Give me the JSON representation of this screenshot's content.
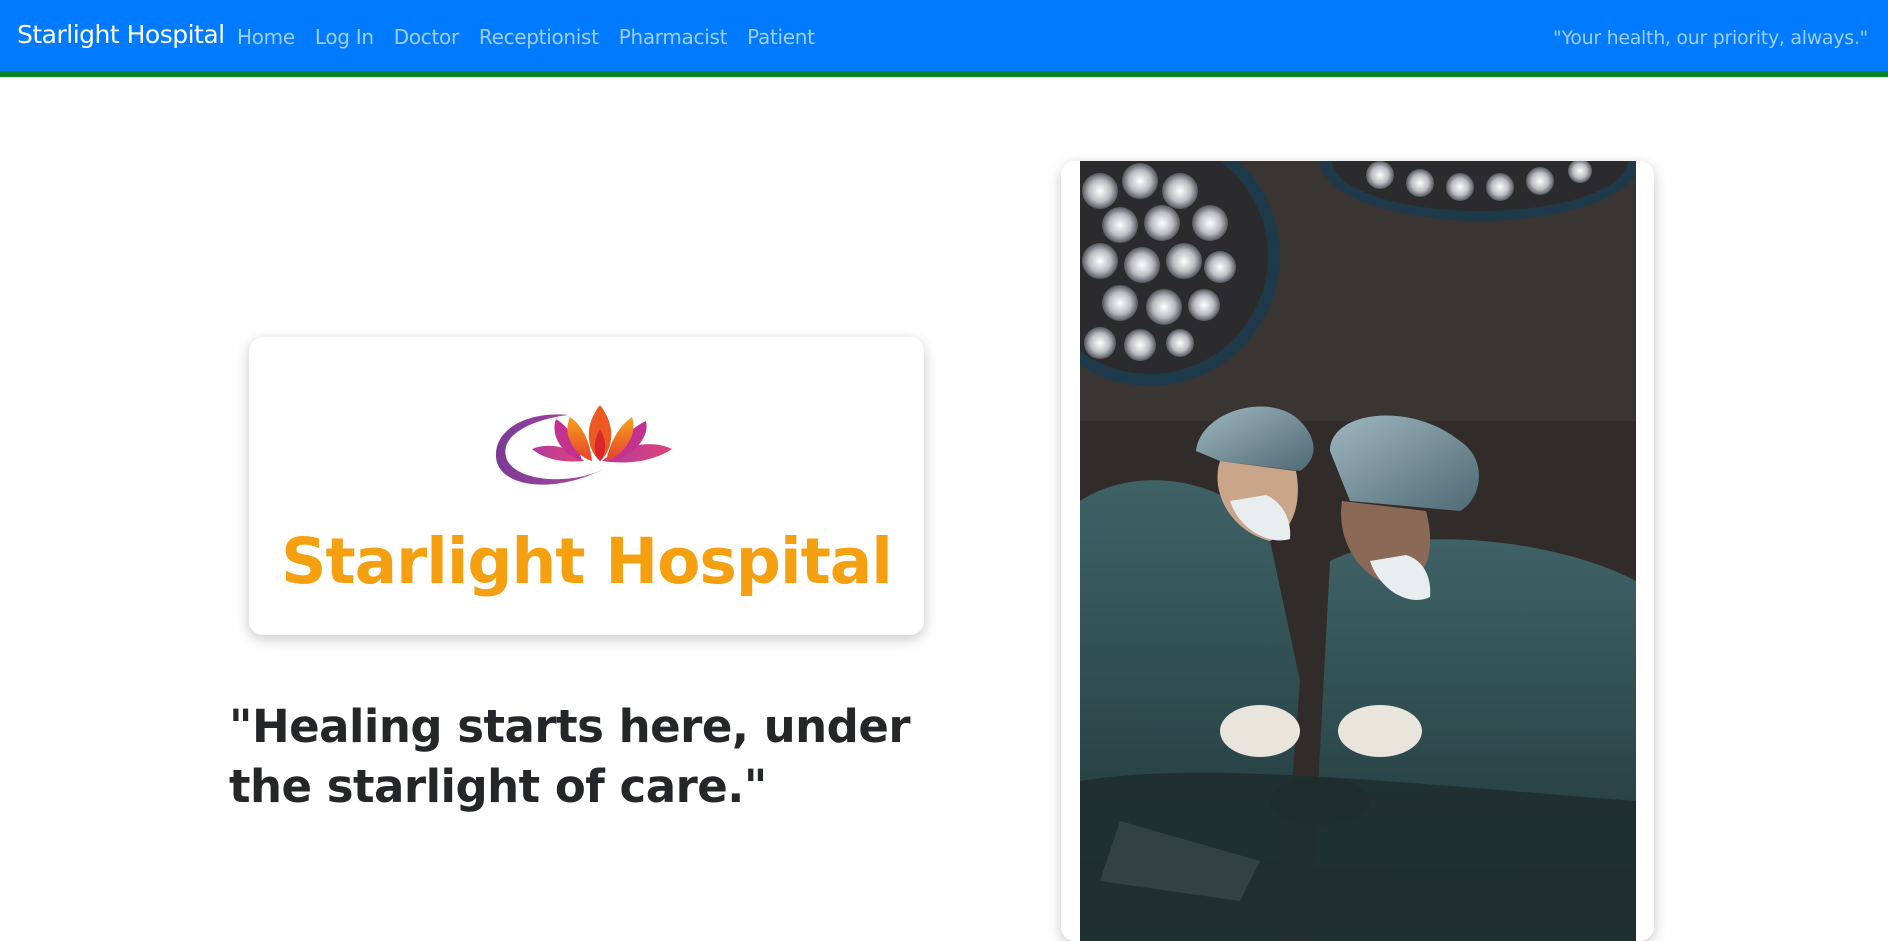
{
  "navbar": {
    "brand": "Starlight Hospital",
    "links": [
      "Home",
      "Log In",
      "Doctor",
      "Receptionist",
      "Pharmacist",
      "Patient"
    ],
    "tagline": "\"Your health, our priority, always.\"",
    "colors": {
      "background": "#007bff",
      "border": "#08852e"
    }
  },
  "hero": {
    "logo_title": "Starlight Hospital",
    "logo_icon": "lotus-logo-icon",
    "quote": "\"Healing starts here, under the starlight of care.\"",
    "colors": {
      "logo_title": "#f5a011",
      "quote": "#24262a"
    }
  },
  "photo": {
    "description_icon": "surgeons-photo"
  }
}
